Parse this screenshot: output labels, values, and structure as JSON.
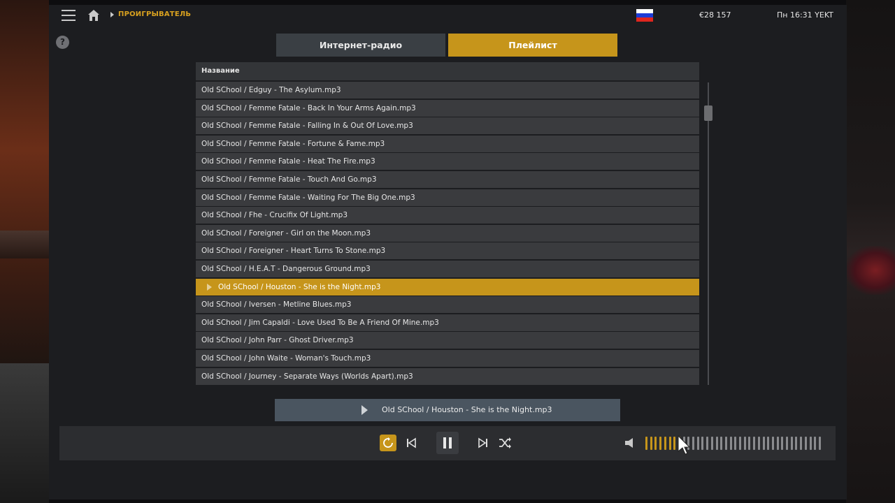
{
  "topbar": {
    "breadcrumb": "ПРОИГРЫВАТЕЛЬ",
    "money": "€28 157",
    "datetime": "Пн 16:31 YEKT",
    "flag_colors": [
      "#ffffff",
      "#1d3bd6",
      "#e0261e"
    ]
  },
  "tabs": {
    "radio": "Интернет-радио",
    "playlist": "Плейлист",
    "active": "playlist"
  },
  "list": {
    "header": "Название",
    "tracks": [
      {
        "title": "Old SChool / Edguy - The Asylum.mp3",
        "active": false
      },
      {
        "title": "Old SChool / Femme Fatale - Back In Your Arms Again.mp3",
        "active": false
      },
      {
        "title": "Old SChool / Femme Fatale - Falling In & Out Of Love.mp3",
        "active": false
      },
      {
        "title": "Old SChool / Femme Fatale - Fortune & Fame.mp3",
        "active": false
      },
      {
        "title": "Old SChool / Femme Fatale - Heat The Fire.mp3",
        "active": false
      },
      {
        "title": "Old SChool / Femme Fatale - Touch And Go.mp3",
        "active": false
      },
      {
        "title": "Old SChool / Femme Fatale - Waiting For The Big One.mp3",
        "active": false
      },
      {
        "title": "Old SChool / Fhe - Crucifix Of Light.mp3",
        "active": false
      },
      {
        "title": "Old SChool / Foreigner - Girl on the Moon.mp3",
        "active": false
      },
      {
        "title": "Old SChool / Foreigner - Heart Turns To Stone.mp3",
        "active": false
      },
      {
        "title": "Old SChool / H.E.A.T - Dangerous Ground.mp3",
        "active": false
      },
      {
        "title": "Old SChool / Houston - She is the Night.mp3",
        "active": true
      },
      {
        "title": "Old SChool / Iversen - Metline Blues.mp3",
        "active": false
      },
      {
        "title": "Old SChool / Jim Capaldi - Love Used To Be A Friend Of Mine.mp3",
        "active": false
      },
      {
        "title": "Old SChool / John Parr - Ghost Driver.mp3",
        "active": false
      },
      {
        "title": "Old SChool / John Waite - Woman's Touch.mp3",
        "active": false
      },
      {
        "title": "Old SChool / Journey - Separate Ways (Worlds Apart).mp3",
        "active": false
      }
    ]
  },
  "now_playing": {
    "title": "Old SChool / Houston - She is the Night.mp3"
  },
  "controls": {
    "repeat_active": true,
    "state": "playing",
    "volume_segments_total": 38,
    "volume_segments_filled": 8
  },
  "colors": {
    "accent": "#c6951b",
    "panel": "#1c1d20",
    "row": "#3a3b3e",
    "volume_empty": "#8a8b8e"
  }
}
